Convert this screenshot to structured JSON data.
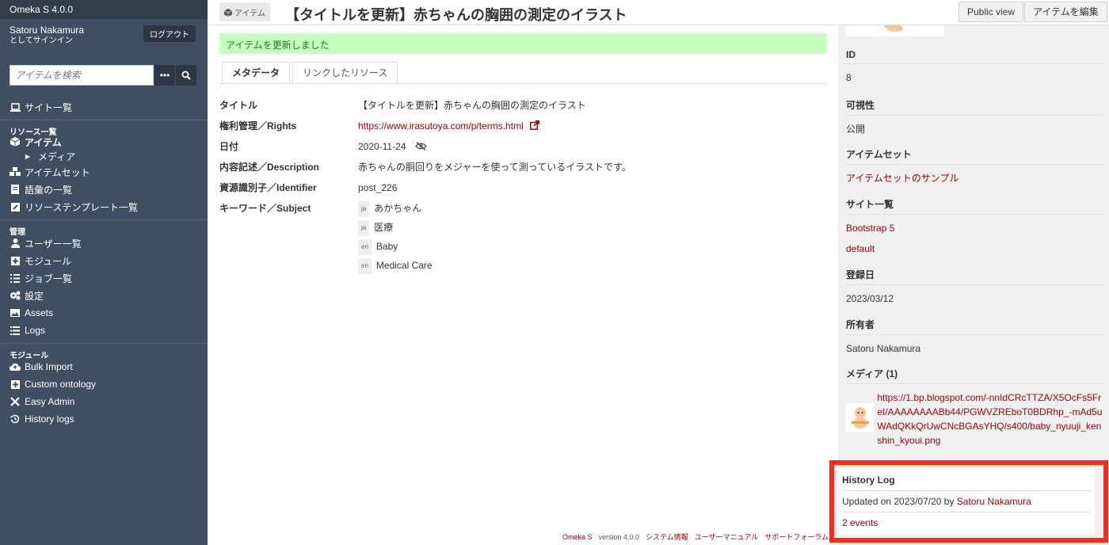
{
  "brand": "Omeka S 4.0.0",
  "user": {
    "name": "Satoru Nakamura",
    "signed_in": "としてサインイン",
    "logout": "ログアウト"
  },
  "search": {
    "placeholder": "アイテムを検索"
  },
  "nav": {
    "site_list": "サイト一覧",
    "resources_head": "リソース一覧",
    "items": "アイテム",
    "media": "メディア",
    "item_sets": "アイテムセット",
    "vocabularies": "語彙の一覧",
    "templates": "リソーステンプレート一覧",
    "admin_head": "管理",
    "users": "ユーザー一覧",
    "modules": "モジュール",
    "jobs": "ジョブ一覧",
    "settings": "設定",
    "assets": "Assets",
    "logs": "Logs",
    "modules_head": "モジュール",
    "bulk_import": "Bulk Import",
    "custom_ontology": "Custom ontology",
    "easy_admin": "Easy Admin",
    "history_logs": "History logs"
  },
  "header": {
    "crumb": "アイテム",
    "title": "【タイトルを更新】赤ちゃんの胸囲の測定のイラスト",
    "public_view": "Public view",
    "edit": "アイテムを編集"
  },
  "flash": "アイテムを更新しました",
  "tabs": {
    "metadata": "メタデータ",
    "linked": "リンクしたリソース"
  },
  "props": {
    "title_k": "タイトル",
    "title_v": "【タイトルを更新】赤ちゃんの胸囲の測定のイラスト",
    "rights_k": "権利管理／Rights",
    "rights_v": "https://www.irasutoya.com/p/terms.html",
    "date_k": "日付",
    "date_v": "2020-11-24",
    "desc_k": "内容記述／Description",
    "desc_v": "赤ちゃんの胴回りをメジャーを使って測っているイラストです。",
    "id_k": "資源識別子／Identifier",
    "id_v": "post_226",
    "subject_k": "キーワード／Subject",
    "subjects": [
      {
        "lang": "ja",
        "value": "あかちゃん"
      },
      {
        "lang": "ja",
        "value": "医療"
      },
      {
        "lang": "en",
        "value": "Baby"
      },
      {
        "lang": "en",
        "value": "Medical Care"
      }
    ]
  },
  "footer": {
    "omeka": "Omeka S",
    "version": "version 4.0.0",
    "sysinfo": "システム情報",
    "manual": "ユーザーマニュアル",
    "forum": "サポートフォーラム"
  },
  "aside": {
    "id_h": "ID",
    "id_v": "8",
    "vis_h": "可視性",
    "vis_v": "公開",
    "sets_h": "アイテムセット",
    "sets_v": "アイテムセットのサンプル",
    "sites_h": "サイト一覧",
    "site1": "Bootstrap 5",
    "site2": "default",
    "created_h": "登録日",
    "created_v": "2023/03/12",
    "owner_h": "所有者",
    "owner_v": "Satoru Nakamura",
    "media_h": "メディア (1)",
    "media_link": "https://1.bp.blogspot.com/-nnIdCRcTTZA/X5OcFs5FreI/AAAAAAAABb44/PGWVZREboT0BDRhp_-mAd5uWAdQKkQrUwCNcBGAsYHQ/s400/baby_nyuuji_kenshin_kyoui.png"
  },
  "history": {
    "title": "History Log",
    "updated_prefix": "Updated on 2023/07/20 by ",
    "updated_by": "Satoru Nakamura",
    "events": "2 events"
  },
  "colors": {
    "sidebar": "#404e61",
    "link": "#a3000a",
    "highlight": "#ff2a16",
    "flash": "#c6ffbf"
  }
}
